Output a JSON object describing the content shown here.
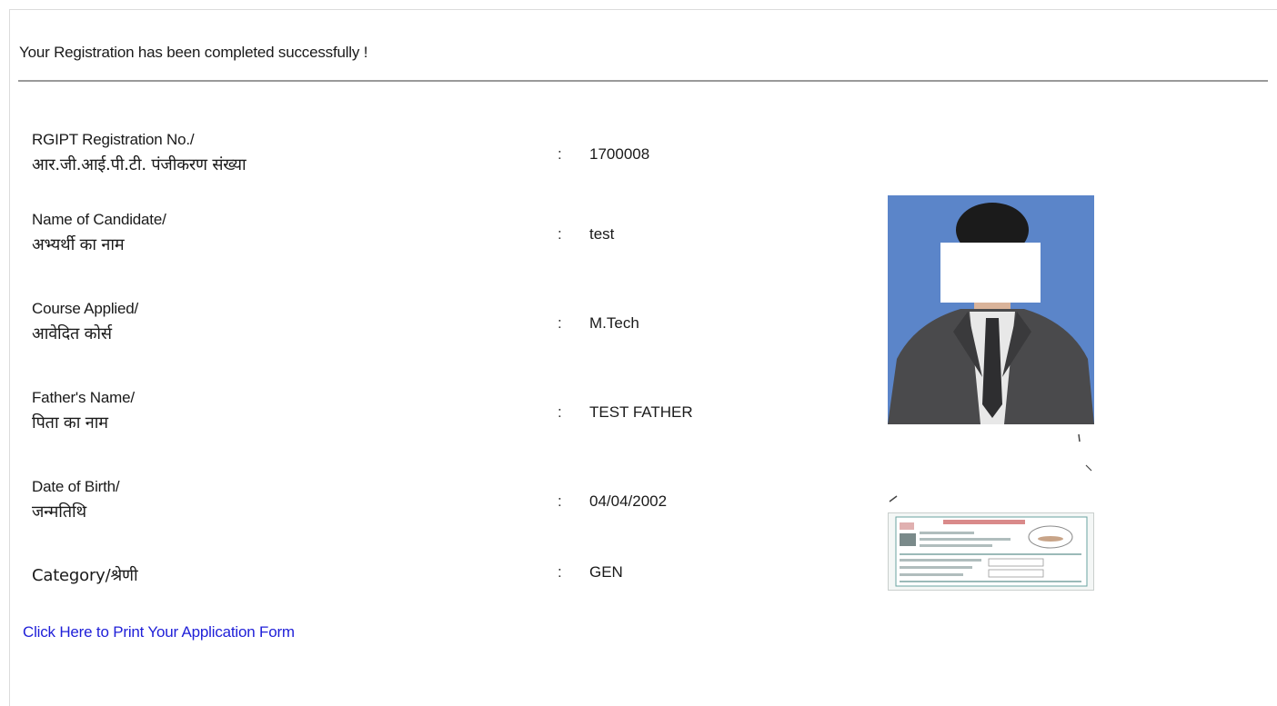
{
  "message": "Your Registration has been completed successfully !",
  "fields": [
    {
      "label_en": "RGIPT Registration No./",
      "label_hi": "आर.जी.आई.पी.टी. पंजीकरण संख्या",
      "value": "1700008"
    },
    {
      "label_en": "Name of Candidate/",
      "label_hi": "अभ्यर्थी का नाम",
      "value": "test"
    },
    {
      "label_en": "Course Applied/",
      "label_hi": "आवेदित कोर्स",
      "value": "M.Tech"
    },
    {
      "label_en": "Father's Name/",
      "label_hi": "पिता का नाम",
      "value": "TEST FATHER"
    },
    {
      "label_en": "Date of Birth/",
      "label_hi": "जन्मतिथि",
      "value": "04/04/2002"
    },
    {
      "label_en": "Category/श्रेणी",
      "label_hi": "",
      "value": "GEN"
    }
  ],
  "separator": ":",
  "print_link": "Click Here to Print Your Application Form",
  "colors": {
    "link": "#1f1fd8",
    "photo_bg": "#5b85c9",
    "divider": "#9a9a9a"
  }
}
